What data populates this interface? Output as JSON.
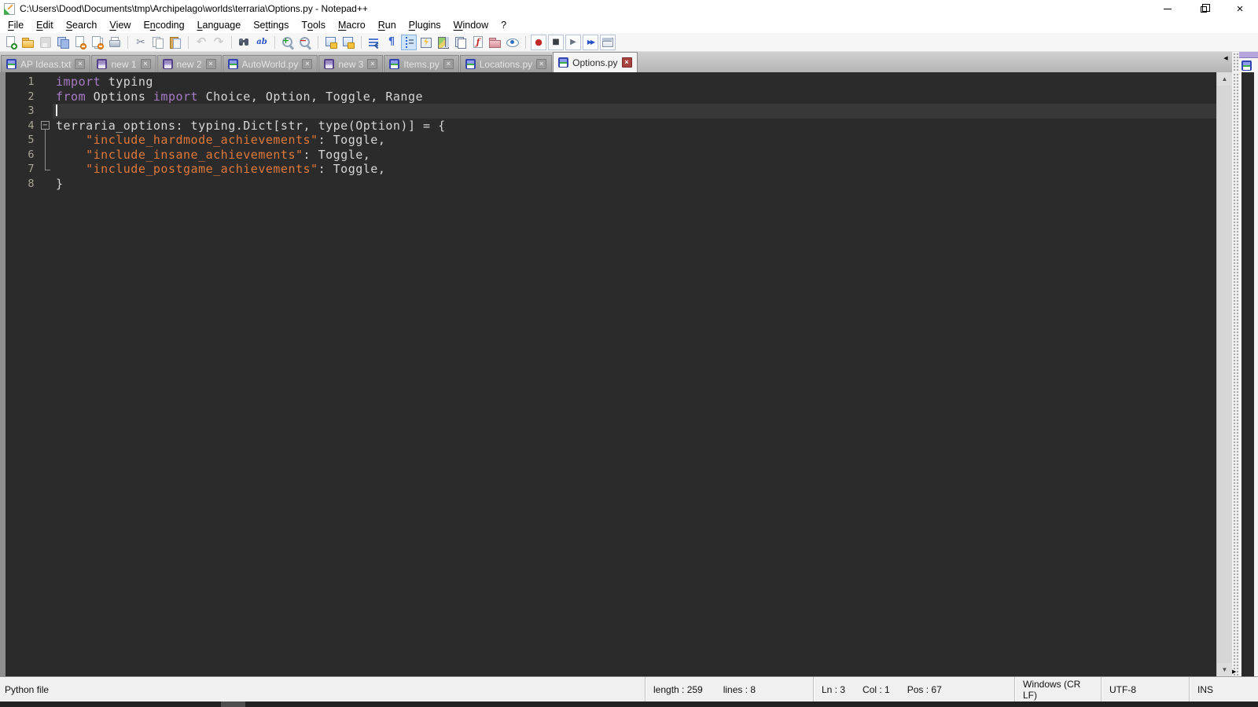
{
  "window": {
    "title": "C:\\Users\\Dood\\Documents\\tmp\\Archipelago\\worlds\\terraria\\Options.py - Notepad++",
    "controls": [
      "minimize",
      "restore",
      "close"
    ]
  },
  "icons": {
    "close_x": "×",
    "fold_collapse": "−",
    "scroll_up": "▲",
    "scroll_down": "▼",
    "tab_scroll_left": "◀",
    "splitter_expand_right": "▶"
  },
  "menu": {
    "items": [
      {
        "name": "file",
        "label": "File",
        "u": 0
      },
      {
        "name": "edit",
        "label": "Edit",
        "u": 0
      },
      {
        "name": "search",
        "label": "Search",
        "u": 0
      },
      {
        "name": "view",
        "label": "View",
        "u": 0
      },
      {
        "name": "encoding",
        "label": "Encoding",
        "u": 1
      },
      {
        "name": "language",
        "label": "Language",
        "u": 0
      },
      {
        "name": "settings",
        "label": "Settings",
        "u": 2
      },
      {
        "name": "tools",
        "label": "Tools",
        "u": 1
      },
      {
        "name": "macro",
        "label": "Macro",
        "u": 0
      },
      {
        "name": "run",
        "label": "Run",
        "u": 0
      },
      {
        "name": "plugins",
        "label": "Plugins",
        "u": 0
      },
      {
        "name": "window",
        "label": "Window",
        "u": 0
      },
      {
        "name": "help",
        "label": "?",
        "u": -1
      }
    ]
  },
  "toolbar": {
    "buttons": [
      {
        "icon": "new-file"
      },
      {
        "icon": "open"
      },
      {
        "icon": "save",
        "disabled": true
      },
      {
        "icon": "save-all"
      },
      {
        "icon": "close"
      },
      {
        "icon": "close-all"
      },
      {
        "icon": "print"
      },
      {
        "sep": true
      },
      {
        "icon": "cut",
        "glyph": "✂"
      },
      {
        "icon": "copy"
      },
      {
        "icon": "paste"
      },
      {
        "sep": true
      },
      {
        "icon": "undo",
        "glyph": "↶",
        "disabled": true
      },
      {
        "icon": "redo",
        "glyph": "↷",
        "disabled": true
      },
      {
        "sep": true
      },
      {
        "icon": "find"
      },
      {
        "icon": "replace",
        "glyph": "ab"
      },
      {
        "sep": true
      },
      {
        "icon": "zoom-in",
        "glyph": "+"
      },
      {
        "icon": "zoom-out",
        "glyph": "−"
      },
      {
        "sep": true
      },
      {
        "icon": "sync-vertical"
      },
      {
        "icon": "sync-horizontal"
      },
      {
        "sep": true
      },
      {
        "icon": "word-wrap"
      },
      {
        "icon": "show-all-characters",
        "glyph": "¶"
      },
      {
        "icon": "indent-guide",
        "active": true
      },
      {
        "icon": "define-language"
      },
      {
        "icon": "document-map"
      },
      {
        "icon": "document-switcher"
      },
      {
        "icon": "function-list",
        "glyph": "ƒ"
      },
      {
        "icon": "folder-as-workspace"
      },
      {
        "icon": "monitoring"
      },
      {
        "sep": true
      },
      {
        "icon": "macro-record",
        "glyph": "●",
        "boxed": true
      },
      {
        "icon": "macro-stop",
        "glyph": "■",
        "boxed": true
      },
      {
        "icon": "macro-play",
        "glyph": "▶",
        "boxed": true
      },
      {
        "icon": "macro-run-multiple",
        "glyph": "▶▶",
        "boxed": true
      },
      {
        "icon": "macro-save",
        "boxed": true
      }
    ]
  },
  "tabbar": {
    "tabs": [
      {
        "name": "ap-ideas-txt",
        "label": "AP Ideas.txt",
        "state": "saved",
        "active": false
      },
      {
        "name": "new-1",
        "label": "new 1",
        "state": "unsaved",
        "active": false
      },
      {
        "name": "new-2",
        "label": "new 2",
        "state": "unsaved",
        "active": false
      },
      {
        "name": "autoworld-py",
        "label": "AutoWorld.py",
        "state": "saved",
        "active": false
      },
      {
        "name": "new-3",
        "label": "new 3",
        "state": "unsaved",
        "active": false
      },
      {
        "name": "items-py",
        "label": "Items.py",
        "state": "saved",
        "active": false
      },
      {
        "name": "locations-py",
        "label": "Locations.py",
        "state": "saved",
        "active": false
      },
      {
        "name": "options-py",
        "label": "Options.py",
        "state": "saved",
        "active": true
      }
    ]
  },
  "editor": {
    "caret_line": 3,
    "lines": [
      {
        "n": 1,
        "fold": "",
        "segs": [
          {
            "c": "kw",
            "t": "import"
          },
          {
            "c": "d",
            "t": " typing"
          }
        ]
      },
      {
        "n": 2,
        "fold": "",
        "segs": [
          {
            "c": "kw",
            "t": "from"
          },
          {
            "c": "d",
            "t": " Options "
          },
          {
            "c": "kw",
            "t": "import"
          },
          {
            "c": "d",
            "t": " Choice, Option, Toggle, Range"
          }
        ]
      },
      {
        "n": 3,
        "fold": "",
        "segs": []
      },
      {
        "n": 4,
        "fold": "start",
        "segs": [
          {
            "c": "d",
            "t": "terraria_options: typing.Dict[str, type(Option)] = {"
          }
        ]
      },
      {
        "n": 5,
        "fold": "mid",
        "segs": [
          {
            "c": "d",
            "t": "    "
          },
          {
            "c": "str",
            "t": "\"include_hardmode_achievements\""
          },
          {
            "c": "d",
            "t": ": Toggle,"
          }
        ]
      },
      {
        "n": 6,
        "fold": "mid",
        "segs": [
          {
            "c": "d",
            "t": "    "
          },
          {
            "c": "str",
            "t": "\"include_insane_achievements\""
          },
          {
            "c": "d",
            "t": ": Toggle,"
          }
        ]
      },
      {
        "n": 7,
        "fold": "end",
        "segs": [
          {
            "c": "d",
            "t": "    "
          },
          {
            "c": "str",
            "t": "\"include_postgame_achievements\""
          },
          {
            "c": "d",
            "t": ": Toggle,"
          }
        ]
      },
      {
        "n": 8,
        "fold": "",
        "segs": [
          {
            "c": "d",
            "t": "}"
          }
        ]
      }
    ]
  },
  "second_view": {
    "file_icon": "saved"
  },
  "status": {
    "doc_type": "Python file",
    "length": "length : 259",
    "lines": "lines : 8",
    "ln": "Ln : 3",
    "col": "Col : 1",
    "pos": "Pos : 67",
    "eol": "Windows (CR LF)",
    "encoding": "UTF-8",
    "typing_mode": "INS"
  },
  "colors": {
    "editor_bg": "#2b2b2b",
    "editor_fg": "#d6d6d6",
    "keyword": "#a57bc4",
    "string": "#e0783a",
    "line_number": "#a9a596",
    "caret_line_bg": "#383838",
    "tab_active_bg": "#f4f4f4",
    "tabbar_bg": "#b5b5b5",
    "titlebar_bg": "#ffffff",
    "toolbar_bg": "#f6f6f6",
    "statusbar_bg": "#f0f0f0",
    "accent_close": "#a8423f",
    "view2_tab": "#b4a5dc"
  }
}
